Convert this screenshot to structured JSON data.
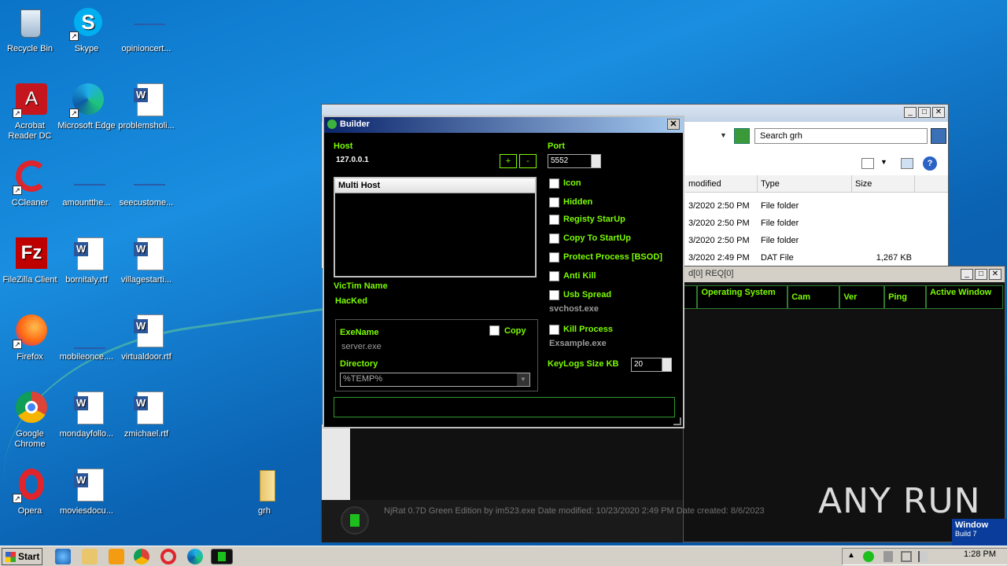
{
  "desktop": {
    "icons": [
      {
        "label": "Recycle Bin",
        "icon": "recycle-bin-icon"
      },
      {
        "label": "Skype",
        "icon": "skype-icon"
      },
      {
        "label": "opinioncert...",
        "icon": "file-icon"
      },
      {
        "label": "Acrobat Reader DC",
        "icon": "acrobat-icon"
      },
      {
        "label": "Microsoft Edge",
        "icon": "edge-icon"
      },
      {
        "label": "problemsholi...",
        "icon": "word-doc-icon"
      },
      {
        "label": "CCleaner",
        "icon": "ccleaner-icon"
      },
      {
        "label": "amountthe...",
        "icon": "file-icon"
      },
      {
        "label": "seecustome...",
        "icon": "file-icon"
      },
      {
        "label": "FileZilla Client",
        "icon": "filezilla-icon"
      },
      {
        "label": "bornitaly.rtf",
        "icon": "word-doc-icon"
      },
      {
        "label": "villagestarti...",
        "icon": "word-doc-icon"
      },
      {
        "label": "Firefox",
        "icon": "firefox-icon"
      },
      {
        "label": "mobileonce....",
        "icon": "file-icon"
      },
      {
        "label": "virtualdoor.rtf",
        "icon": "word-doc-icon"
      },
      {
        "label": "Google Chrome",
        "icon": "chrome-icon"
      },
      {
        "label": "mondayfollo...",
        "icon": "word-doc-icon"
      },
      {
        "label": "zmichael.rtf",
        "icon": "word-doc-icon"
      },
      {
        "label": "Opera",
        "icon": "opera-icon"
      },
      {
        "label": "moviesdocu...",
        "icon": "word-doc-icon"
      },
      {
        "label": "grh",
        "icon": "folder-icon"
      }
    ]
  },
  "explorer": {
    "search_placeholder": "Search grh",
    "columns": [
      "modified",
      "Type",
      "Size"
    ],
    "rows": [
      {
        "modified": "3/2020 2:50 PM",
        "type": "File folder",
        "size": ""
      },
      {
        "modified": "3/2020 2:50 PM",
        "type": "File folder",
        "size": ""
      },
      {
        "modified": "3/2020 2:50 PM",
        "type": "File folder",
        "size": ""
      },
      {
        "modified": "3/2020 2:49 PM",
        "type": "DAT File",
        "size": "1,267 KB"
      }
    ]
  },
  "rat": {
    "title_fragment": "d[0] REQ[0]",
    "columns": [
      "Operating System",
      "Cam",
      "Ver",
      "Ping",
      "Active Window"
    ],
    "status_text": "NjRat 0.7D Green Edition by im523.exe Date modified: 10/23/2020 2:49 PM     Date created: 8/6/2023",
    "corner_text": "Window",
    "corner_sub": "Build 7"
  },
  "builder": {
    "title": "Builder",
    "host_label": "Host",
    "host_value": "127.0.0.1",
    "add_button": "+",
    "remove_button": "-",
    "port_label": "Port",
    "port_value": "5552",
    "multi_host_header": "Multi Host",
    "victim_name_label": "VicTim Name",
    "victim_name_value": "HacKed",
    "exename_label": "ExeName",
    "exename_value": "server.exe",
    "copy_label": "Copy",
    "directory_label": "Directory",
    "directory_value": "%TEMP%",
    "options": {
      "icon": "Icon",
      "hidden": "Hidden",
      "registry": "Registy StarUp",
      "copy_startup": "Copy To StartUp",
      "protect": "Protect Process [BSOD]",
      "antikill": "Anti Kill",
      "usb": "Usb Spread",
      "usb_value": "svchost.exe",
      "killproc": "Kill Process",
      "killproc_value": "Exsample.exe"
    },
    "keylogs_label": "KeyLogs Size KB",
    "keylogs_value": "20"
  },
  "taskbar": {
    "start_label": "Start",
    "clock": "1:28 PM"
  },
  "watermark": "ANY RUN"
}
